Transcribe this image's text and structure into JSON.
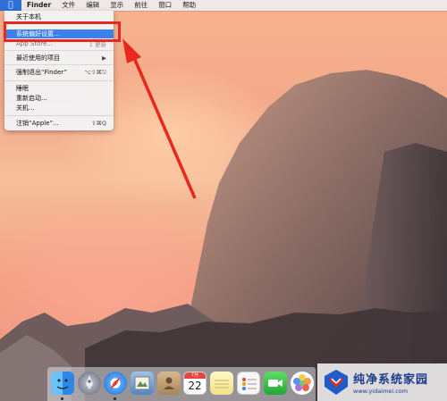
{
  "menubar": {
    "apple_icon": "apple-logo-icon",
    "items": [
      "Finder",
      "文件",
      "编辑",
      "显示",
      "前往",
      "窗口",
      "帮助"
    ]
  },
  "apple_menu": {
    "about": "关于本机",
    "system_prefs": "系统偏好设置...",
    "app_store": "App Store...",
    "app_store_badge": "1 更新",
    "recent_items": "最近使用的项目",
    "force_quit": "强制退出“Finder”",
    "force_quit_shortcut": "⌥⇧⌘⎋",
    "sleep": "睡眠",
    "restart": "重新启动...",
    "shutdown": "关机...",
    "logout": "注销“Apple”...",
    "logout_shortcut": "⇧⌘Q"
  },
  "dock": {
    "calendar_month": "7月",
    "calendar_day": "22",
    "icons": [
      "finder-icon",
      "launchpad-icon",
      "safari-icon",
      "mail-icon",
      "contacts-icon",
      "calendar-icon",
      "notes-icon",
      "reminders-icon",
      "facetime-icon",
      "photos-icon"
    ]
  },
  "watermark": {
    "title": "纯净系统家园",
    "url": "www.yidaimei.com"
  },
  "colors": {
    "highlight": "#3b80ec",
    "annotation": "#e8271d"
  }
}
